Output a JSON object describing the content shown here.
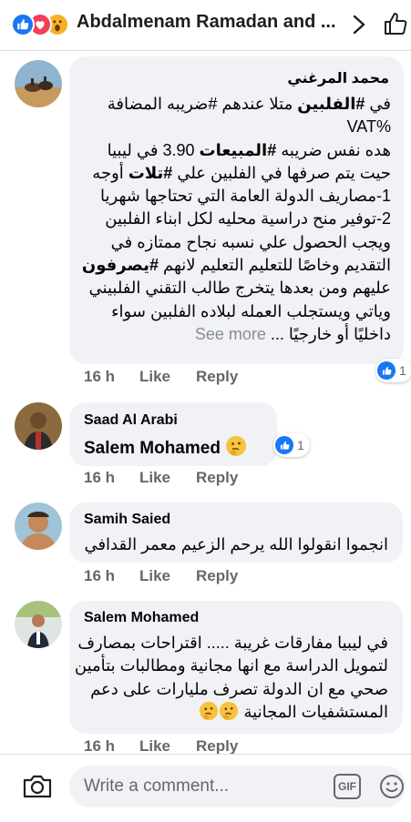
{
  "header": {
    "title": "Abdalmenam Ramadan and ...",
    "icons": [
      "like-icon",
      "love-icon",
      "wow-icon",
      "chevron-right-icon",
      "thumbs-up-icon"
    ]
  },
  "comments": [
    {
      "author": "محمد المرغني",
      "lines": [
        {
          "pre": "في ",
          "bold": "#الفلبين",
          "post": " متلا عندهم #ضريبه المضافة"
        },
        {
          "pre": "",
          "bold": "",
          "post": "%VAT"
        },
        {
          "pre": "هده نفس ضريبه ",
          "bold": "#المبيعات",
          "post": " 3.90 في ليبيا"
        },
        {
          "pre": "حيت يتم صرفها في الفلبين علي ",
          "bold": "#تلات",
          "post": " أوجه"
        },
        {
          "pre": "",
          "bold": "",
          "post": "1-مصاريف الدولة العامة التي تحتاجها شهريا"
        },
        {
          "pre": "",
          "bold": "",
          "post": "2-توفير منح دراسية محليه لكل ابناء الفلبين"
        },
        {
          "pre": "",
          "bold": "",
          "post": "ويجب الحصول علي نسبه نجاح ممتازه في"
        },
        {
          "pre": "التقديم وخاصًا للتعليم التعليم لانهم ",
          "bold": "#يصرفون",
          "post": ""
        },
        {
          "pre": "",
          "bold": "",
          "post": "عليهم ومن بعدها يتخرج طالب التقني الفلبيني"
        },
        {
          "pre": "",
          "bold": "",
          "post": "وياتي ويستجلب العمله لبلاده الفلبين سواء"
        },
        {
          "pre": "",
          "bold": "",
          "post": "داخليًا أو خارجيًا ..."
        }
      ],
      "see_more": "See more",
      "time": "16 h",
      "like": "Like",
      "reply": "Reply",
      "reaction_count": "1"
    },
    {
      "author": "Saad Al Arabi",
      "text": "Salem Mohamed",
      "time": "16 h",
      "like": "Like",
      "reply": "Reply",
      "reaction_count": "1"
    },
    {
      "author": "Samih Saied",
      "text": "انجموا انقولوا الله يرحم الزعيم معمر القدافي",
      "time": "16 h",
      "like": "Like",
      "reply": "Reply"
    },
    {
      "author": "Salem Mohamed",
      "lines": [
        "في ليبيا مفارقات غريبة ..... اقتراحات بمصارف",
        "لتمويل الدراسة مع انها مجانية ومطالبات بتأمين",
        "صحي مع ان الدولة تصرف مليارات على دعم",
        "المستشفيات المجانية"
      ],
      "time": "16 h",
      "like": "Like",
      "reply": "Reply"
    }
  ],
  "composer": {
    "placeholder": "Write a comment...",
    "gif_label": "GIF"
  },
  "colors": {
    "facebook_blue": "#1877f2",
    "bubble_bg": "#f0f2f5",
    "meta_gray": "#65676b"
  }
}
